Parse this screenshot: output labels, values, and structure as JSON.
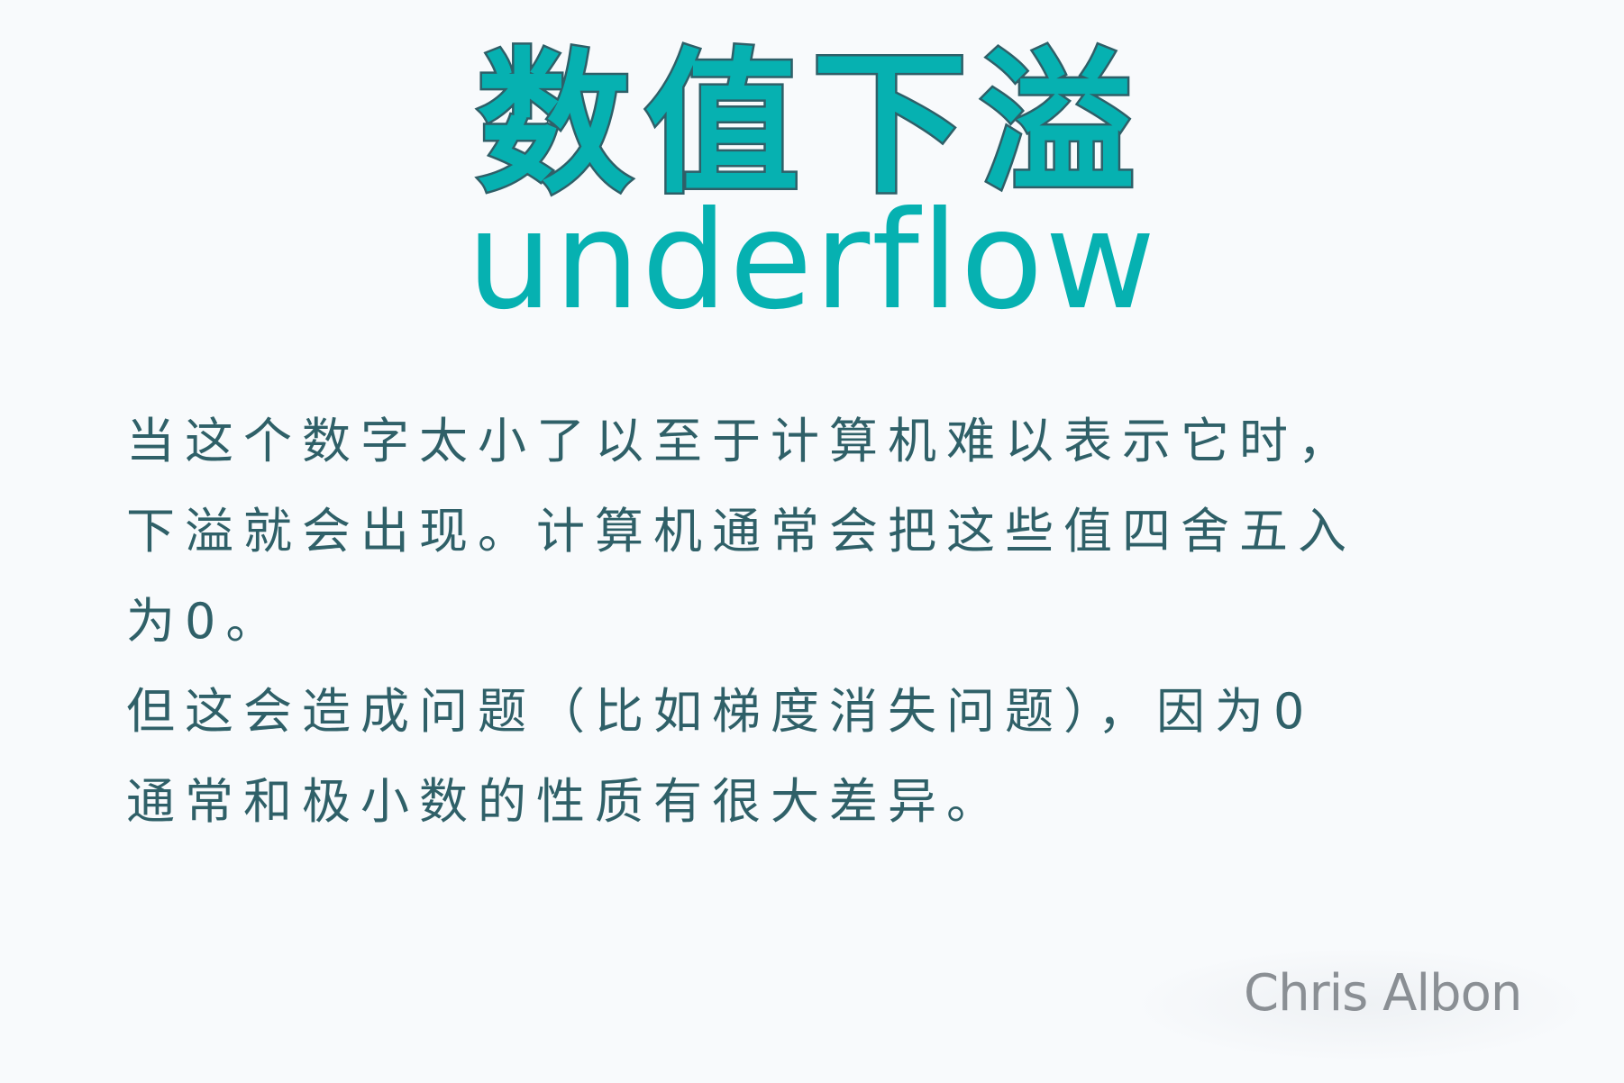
{
  "title": "数值下溢",
  "subtitle": "underflow",
  "body_lines": [
    "当这个数字太小了以至于计算机难以表示它时，",
    "下溢就会出现。计算机通常会把这些值四舍五入",
    "为0。",
    "但这会造成问题（比如梯度消失问题），因为0",
    "通常和极小数的性质有很大差异。"
  ],
  "signature": "Chris Albon",
  "colors": {
    "title_fill": "#06b1b1",
    "title_outline": "#2f5f68",
    "body_text": "#2f6068",
    "background": "#f8fafc"
  }
}
